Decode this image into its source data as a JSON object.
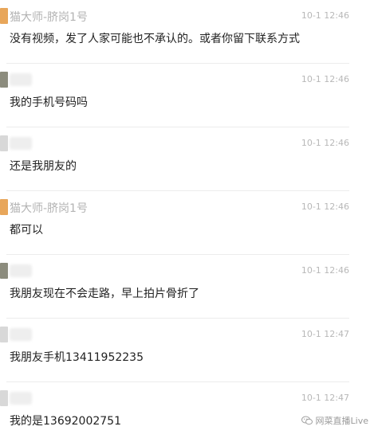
{
  "messages": [
    {
      "sender": "猫大师-脐岗1号",
      "sender_visible": true,
      "time": "10-1 12:46",
      "text": "没有视频，发了人家可能也不承认的。或者你留下联系方式",
      "avatar_color": "#e8a65a"
    },
    {
      "sender": "",
      "sender_visible": false,
      "time": "10-1 12:46",
      "text": "我的手机号码吗",
      "avatar_color": "#8c8c7d"
    },
    {
      "sender": "",
      "sender_visible": false,
      "time": "10-1 12:46",
      "text": "还是我朋友的",
      "avatar_color": "#d8d8d8"
    },
    {
      "sender": "猫大师-脐岗1号",
      "sender_visible": true,
      "time": "10-1 12:46",
      "text": "都可以",
      "avatar_color": "#e8a65a"
    },
    {
      "sender": "",
      "sender_visible": false,
      "time": "10-1 12:46",
      "text": "我朋友现在不会走路，早上拍片骨折了",
      "avatar_color": "#8c8c7d"
    },
    {
      "sender": "",
      "sender_visible": false,
      "time": "10-1 12:47",
      "text": "我朋友手机13411952235",
      "avatar_color": "#d8d8d8"
    },
    {
      "sender": "",
      "sender_visible": false,
      "time": "10-1 12:47",
      "text": "我的是13692002751",
      "avatar_color": "#d8d8d8"
    }
  ],
  "watermark": {
    "text": "网菜直播Live",
    "icon": "wechat-icon"
  }
}
